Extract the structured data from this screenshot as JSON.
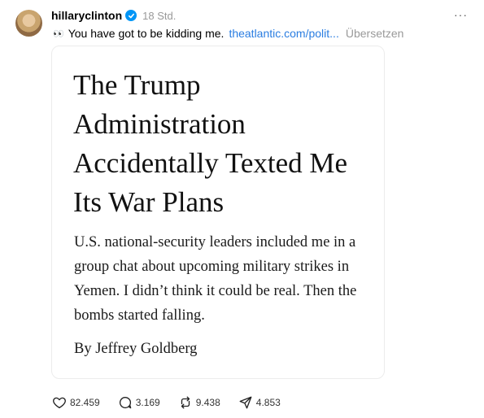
{
  "post": {
    "username": "hillaryclinton",
    "timestamp": "18 Std.",
    "more_icon": "more-options-icon",
    "caption_emoji": "👀",
    "caption_text": "You have got to be kidding me.",
    "link_text": "theatlantic.com/polit...",
    "translate_label": "Übersetzen"
  },
  "article": {
    "headline": "The Trump Administration Accidentally Texted Me Its War Plans",
    "dek": "U.S. national-security leaders included me in a group chat about upcoming military strikes in Yemen. I didn’t think it could be real. Then the bombs started falling.",
    "byline": "By Jeffrey Goldberg"
  },
  "actions": {
    "likes": "82.459",
    "replies": "3.169",
    "reposts": "9.438",
    "shares": "4.853"
  },
  "colors": {
    "verified": "#0095f6",
    "link": "#2a7de1",
    "muted": "#999999"
  }
}
